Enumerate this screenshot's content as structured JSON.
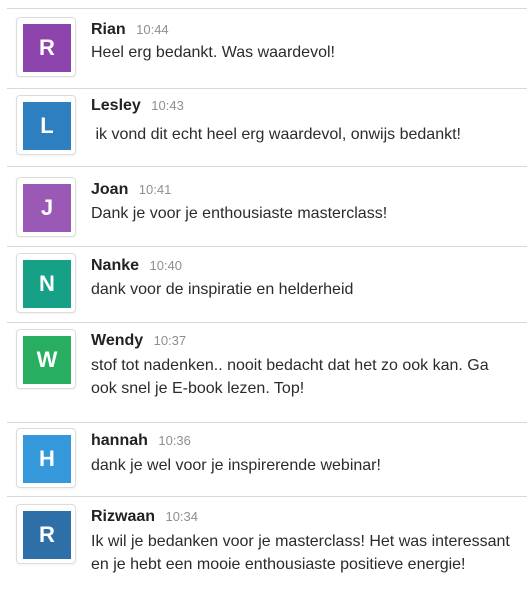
{
  "messages": [
    {
      "initial": "R",
      "name": "Rian",
      "time": "10:44",
      "text": "Heel erg bedankt. Was waardevol!",
      "color": "#8e44ad"
    },
    {
      "initial": "L",
      "name": "Lesley",
      "time": "10:43",
      "text": " ik vond dit echt heel erg waardevol, onwijs bedankt!",
      "color": "#2e7fbf"
    },
    {
      "initial": "J",
      "name": "Joan",
      "time": "10:41",
      "text": "Dank je voor je enthousiaste masterclass!",
      "color": "#9b59b6"
    },
    {
      "initial": "N",
      "name": "Nanke",
      "time": "10:40",
      "text": "dank voor de inspiratie en helderheid",
      "color": "#16a085"
    },
    {
      "initial": "W",
      "name": "Wendy",
      "time": "10:37",
      "text": "stof tot nadenken.. nooit bedacht dat het zo ook kan. Ga ook snel je E-book lezen. Top!",
      "color": "#27ae60"
    },
    {
      "initial": "H",
      "name": "hannah",
      "time": "10:36",
      "text": "dank je wel voor je inspirerende webinar!",
      "color": "#3498db"
    },
    {
      "initial": "R",
      "name": "Rizwaan",
      "time": "10:34",
      "text": "Ik wil je bedanken voor je masterclass! Het was interessant en je hebt een mooie enthousiaste positieve energie!",
      "color": "#2e6fa8"
    }
  ]
}
